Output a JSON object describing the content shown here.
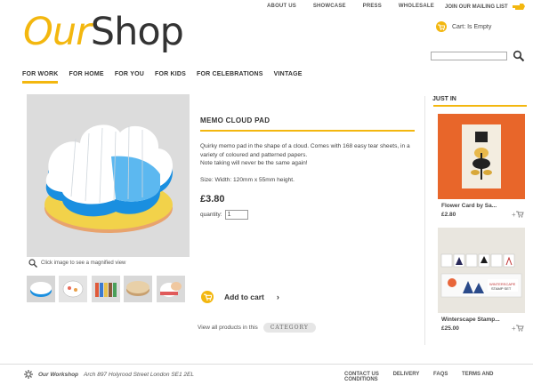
{
  "top_links": [
    "ABOUT US",
    "SHOWCASE",
    "PRESS",
    "WHOLESALE"
  ],
  "mailing_list": "JOIN OUR MAILING LIST",
  "logo": {
    "part1": "Our",
    "part2": "Shop"
  },
  "cart": {
    "label": "Cart: Is Empty"
  },
  "search": {
    "placeholder": ""
  },
  "nav": [
    "FOR WORK",
    "FOR HOME",
    "FOR YOU",
    "FOR KIDS",
    "FOR CELEBRATIONS",
    "VINTAGE"
  ],
  "product": {
    "title": "MEMO CLOUD PAD",
    "description_1": "Quirky memo pad in the shape of a cloud. Comes with 168 easy tear sheets, in a variety of coloured and patterned papers.",
    "description_2": "Note taking will never be the same again!",
    "size": "Size: Width: 120mm x 55mm height.",
    "price": "£3.80",
    "quantity_label": "quantity:",
    "quantity_value": "1",
    "zoom_note": "Click image to see a magnified view",
    "add_to_cart": "Add to cart",
    "view_all": "View all products in this",
    "category": "CATEGORY"
  },
  "just_in": {
    "heading": "JUST IN",
    "items": [
      {
        "title": "Flower Card by Sa...",
        "price": "£2.80"
      },
      {
        "title": "Winterscape Stamp...",
        "price": "£25.00"
      }
    ]
  },
  "footer": {
    "name": "Our Workshop",
    "address": "Arch 897 Holyrood Street London SE1 2EL",
    "links": [
      "CONTACT US",
      "DELIVERY",
      "FAQS",
      "TERMS AND CONDITIONS"
    ]
  },
  "colors": {
    "accent": "#f3b70f",
    "text": "#333333"
  }
}
